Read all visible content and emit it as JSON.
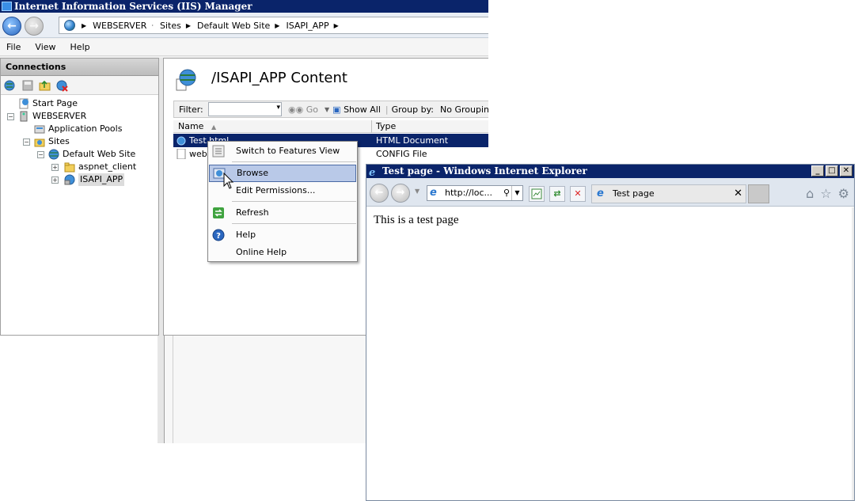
{
  "iis": {
    "title": "Internet Information Services (IIS) Manager",
    "address": [
      "WEBSERVER",
      "Sites",
      "Default Web Site",
      "ISAPI_APP"
    ],
    "menu": [
      "File",
      "View",
      "Help"
    ],
    "connections": {
      "header": "Connections",
      "tree": {
        "start_page": "Start Page",
        "server": "WEBSERVER",
        "app_pools": "Application Pools",
        "sites": "Sites",
        "default_site": "Default Web Site",
        "aspnet_client": "aspnet_client",
        "isapi_app": "ISAPI_APP"
      }
    },
    "content": {
      "title": "/ISAPI_APP Content",
      "filter_label": "Filter:",
      "go_label": "Go",
      "show_all_label": "Show All",
      "group_by_label": "Group by:",
      "group_by_value": "No Groupin",
      "columns": {
        "name": "Name",
        "type": "Type"
      },
      "rows": [
        {
          "name": "Test.html",
          "type": "HTML Document"
        },
        {
          "name": "web",
          "type": "CONFIG File"
        }
      ]
    },
    "context_menu": {
      "switch": "Switch to Features View",
      "browse": "Browse",
      "edit_permissions": "Edit Permissions...",
      "refresh": "Refresh",
      "help": "Help",
      "online_help": "Online Help"
    }
  },
  "ie": {
    "title": "Test page - Windows Internet Explorer",
    "address": "http://loc...",
    "tab_title": "Test page",
    "body_text": "This is a test page"
  },
  "colors": {
    "titlebar": "#0a246a",
    "selection": "#0a246a",
    "menu_highlight": "#b9c9e8"
  }
}
